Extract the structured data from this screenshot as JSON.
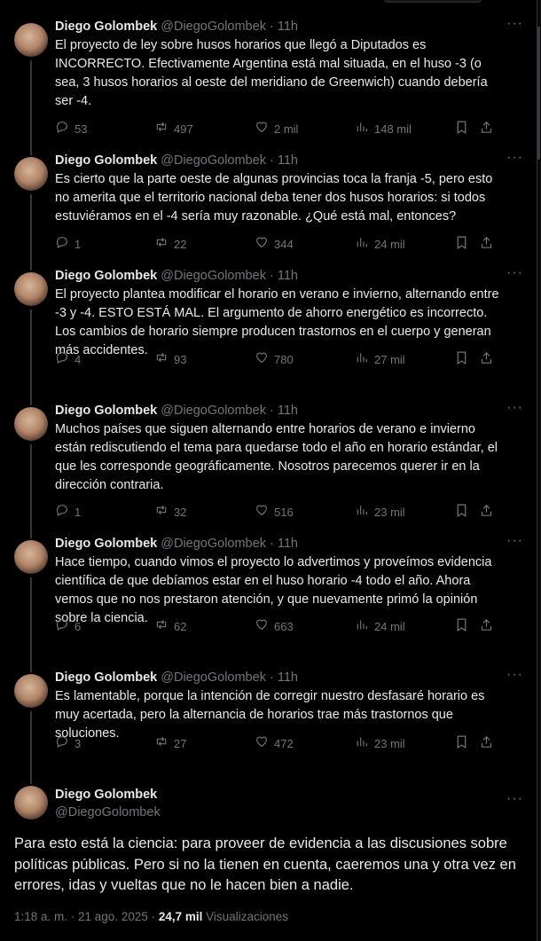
{
  "author": {
    "name": "Diego Golombek",
    "handle": "@DiegoGolombek"
  },
  "thread": [
    {
      "time": "11h",
      "text": "El proyecto de ley sobre husos horarios que llegó a Diputados es INCORRECTO. Efectivamente Argentina está mal situada, en el huso -3 (o sea, 3 husos horarios al oeste del meridiano de Greenwich) cuando debería ser -4.",
      "replies": "53",
      "reposts": "497",
      "likes": "2 mil",
      "views": "148 mil"
    },
    {
      "time": "11h",
      "text": "Es cierto que la parte oeste de algunas provincias toca la franja -5, pero esto no amerita que el territorio nacional deba tener dos husos horarios: si todos estuviéramos en el -4 sería muy razonable. ¿Qué está mal, entonces?",
      "replies": "1",
      "reposts": "22",
      "likes": "344",
      "views": "24 mil"
    },
    {
      "time": "11h",
      "text": "El proyecto plantea modificar el horario en verano e invierno, alternando entre -3 y -4. ESTO ESTÁ MAL. El argumento de ahorro energético es incorrecto. Los cambios de horario siempre producen trastornos en el cuerpo y generan más accidentes.",
      "replies": "4",
      "reposts": "93",
      "likes": "780",
      "views": "27 mil"
    },
    {
      "time": "11h",
      "text": "Muchos países que siguen alternando entre horarios de verano e invierno están rediscutiendo el tema para quedarse todo el año en horario estándar, el que les corresponde geográficamente. Nosotros parecemos querer ir en la dirección contraria.",
      "replies": "1",
      "reposts": "32",
      "likes": "516",
      "views": "23 mil"
    },
    {
      "time": "11h",
      "text": "Hace tiempo, cuando vimos el proyecto lo advertimos y proveímos evidencia científica de que debíamos estar en el huso horario -4 todo el año. Ahora vemos que no nos prestaron atención, y que nuevamente primó la opinión sobre la ciencia.",
      "replies": "6",
      "reposts": "62",
      "likes": "663",
      "views": "24 mil"
    },
    {
      "time": "11h",
      "text": "Es lamentable, porque la intención de corregir nuestro desfasaré horario es muy acertada, pero la alternancia de horarios trae más trastornos que soluciones.",
      "replies": "3",
      "reposts": "27",
      "likes": "472",
      "views": "23 mil"
    }
  ],
  "main_tweet": {
    "text": "Para esto está la ciencia: para proveer de evidencia a las discusiones sobre políticas públicas. Pero si no la tienen en cuenta, caeremos una y otra vez en errores, idas y vueltas que no le hacen bien a nadie.",
    "timestamp": "1:18 a. m. · 21 ago. 2025 ·",
    "views_count": "24,7 mil",
    "views_label": "Visualizaciones"
  },
  "ui": {
    "more_glyph": "···",
    "separator": "·"
  },
  "colors": {
    "background": "#000000",
    "text": "#e7e9ea",
    "muted": "#71767b",
    "thread_line": "#333639"
  },
  "icons": [
    "reply-icon",
    "repost-icon",
    "like-icon",
    "views-icon",
    "bookmark-icon",
    "share-icon",
    "more-icon"
  ]
}
